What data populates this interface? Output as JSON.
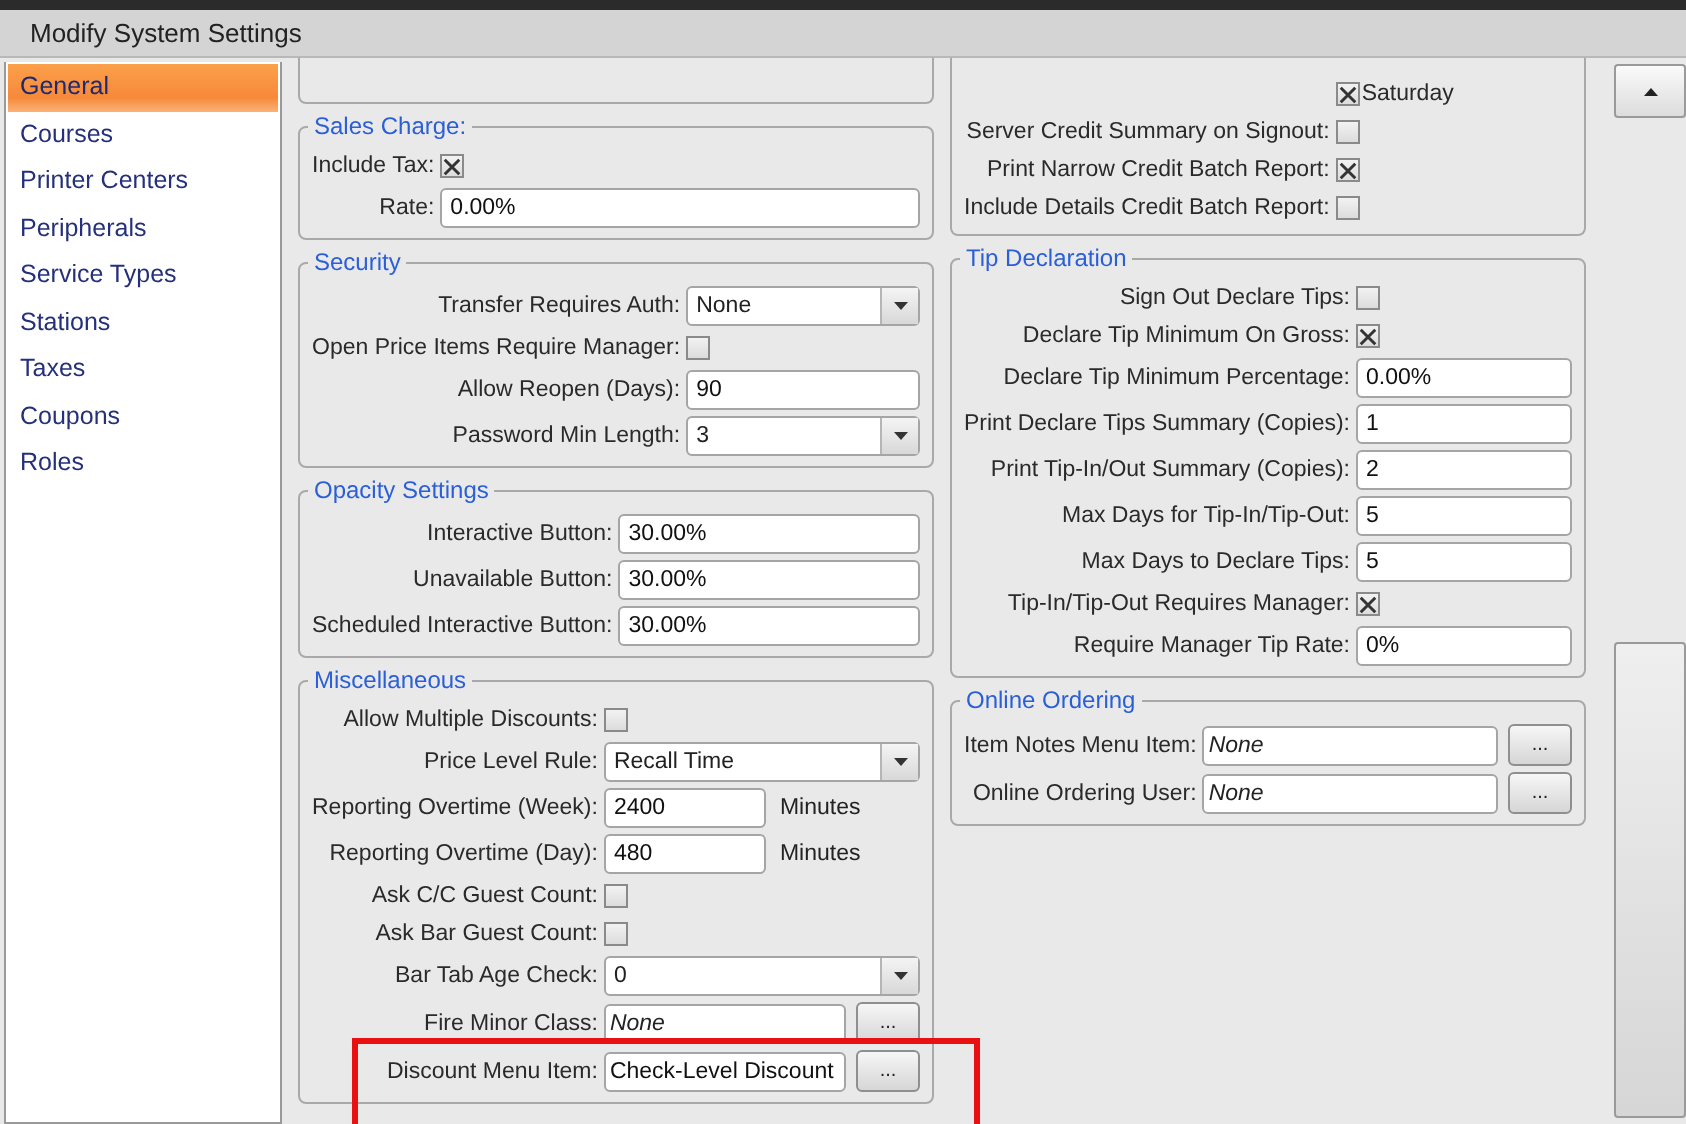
{
  "window": {
    "title": "Modify System Settings"
  },
  "sidebar": {
    "items": [
      {
        "label": "General",
        "selected": true
      },
      {
        "label": "Courses",
        "selected": false
      },
      {
        "label": "Printer Centers",
        "selected": false
      },
      {
        "label": "Peripherals",
        "selected": false
      },
      {
        "label": "Service Types",
        "selected": false
      },
      {
        "label": "Stations",
        "selected": false
      },
      {
        "label": "Taxes",
        "selected": false
      },
      {
        "label": "Coupons",
        "selected": false
      },
      {
        "label": "Roles",
        "selected": false
      }
    ]
  },
  "left_column": [
    {
      "clipped": true
    },
    {
      "clipped": false,
      "title": "Sales Charge:",
      "rows": [
        {
          "kind": "checkbox",
          "label": "Include Tax:",
          "checked": true
        },
        {
          "kind": "text",
          "label": "Rate:",
          "value": "0.00%"
        }
      ]
    },
    {
      "clipped": false,
      "title": "Security",
      "rows": [
        {
          "kind": "select",
          "label": "Transfer Requires Auth:",
          "value": "None"
        },
        {
          "kind": "checkbox",
          "label": "Open Price Items Require Manager:",
          "checked": false
        },
        {
          "kind": "text",
          "label": "Allow Reopen (Days):",
          "value": "90"
        },
        {
          "kind": "select",
          "label": "Password Min Length:",
          "value": "3"
        }
      ]
    },
    {
      "clipped": false,
      "title": "Opacity Settings",
      "rows": [
        {
          "kind": "text",
          "label": "Interactive Button:",
          "value": "30.00%"
        },
        {
          "kind": "text",
          "label": "Unavailable Button:",
          "value": "30.00%"
        },
        {
          "kind": "text",
          "label": "Scheduled Interactive Button:",
          "value": "30.00%"
        }
      ]
    },
    {
      "clipped": false,
      "title": "Miscellaneous",
      "rows": [
        {
          "kind": "checkbox",
          "label": "Allow Multiple Discounts:",
          "checked": false
        },
        {
          "kind": "select",
          "label": "Price Level Rule:",
          "value": "Recall Time"
        },
        {
          "kind": "unit",
          "label": "Reporting Overtime (Week):",
          "value": "2400",
          "unit": "Minutes"
        },
        {
          "kind": "unit",
          "label": "Reporting Overtime (Day):",
          "value": "480",
          "unit": "Minutes"
        },
        {
          "kind": "checkbox",
          "label": "Ask C/C Guest Count:",
          "checked": false
        },
        {
          "kind": "checkbox",
          "label": "Ask Bar Guest Count:",
          "checked": false
        },
        {
          "kind": "select",
          "label": "Bar Tab Age Check:",
          "value": "0"
        },
        {
          "kind": "picker",
          "label": "Fire Minor Class:",
          "placeholder": "None",
          "button": "..."
        },
        {
          "kind": "picker",
          "label": "Discount Menu Item:",
          "value": "Check-Level Discount",
          "button": "..."
        }
      ]
    }
  ],
  "right_column": [
    {
      "clipped": true,
      "rows": [
        {
          "kind": "check_after",
          "label": "Saturday",
          "checked": true
        },
        {
          "kind": "checkbox",
          "label": "Server Credit Summary on Signout:",
          "checked": false
        },
        {
          "kind": "checkbox",
          "label": "Print Narrow Credit Batch Report:",
          "checked": true
        },
        {
          "kind": "checkbox",
          "label": "Include Details Credit Batch Report:",
          "checked": false
        }
      ]
    },
    {
      "clipped": false,
      "title": "Tip Declaration",
      "rows": [
        {
          "kind": "checkbox",
          "label": "Sign Out Declare Tips:",
          "checked": false
        },
        {
          "kind": "checkbox",
          "label": "Declare Tip Minimum On Gross:",
          "checked": true
        },
        {
          "kind": "text",
          "label": "Declare Tip Minimum Percentage:",
          "value": "0.00%"
        },
        {
          "kind": "text",
          "label": "Print Declare Tips Summary (Copies):",
          "value": "1"
        },
        {
          "kind": "text",
          "label": "Print Tip-In/Out Summary (Copies):",
          "value": "2"
        },
        {
          "kind": "text",
          "label": "Max Days for Tip-In/Tip-Out:",
          "value": "5"
        },
        {
          "kind": "text",
          "label": "Max Days to Declare Tips:",
          "value": "5"
        },
        {
          "kind": "checkbox",
          "label": "Tip-In/Tip-Out Requires Manager:",
          "checked": true
        },
        {
          "kind": "text",
          "label": "Require Manager Tip Rate:",
          "value": "0%"
        }
      ]
    },
    {
      "clipped": false,
      "title": "Online Ordering",
      "rows": [
        {
          "kind": "picker",
          "label": "Item Notes Menu Item:",
          "placeholder": "None",
          "button": "..."
        },
        {
          "kind": "picker",
          "label": "Online Ordering User:",
          "placeholder": "None",
          "button": "..."
        }
      ]
    }
  ],
  "annotation": {
    "kind": "highlight"
  }
}
